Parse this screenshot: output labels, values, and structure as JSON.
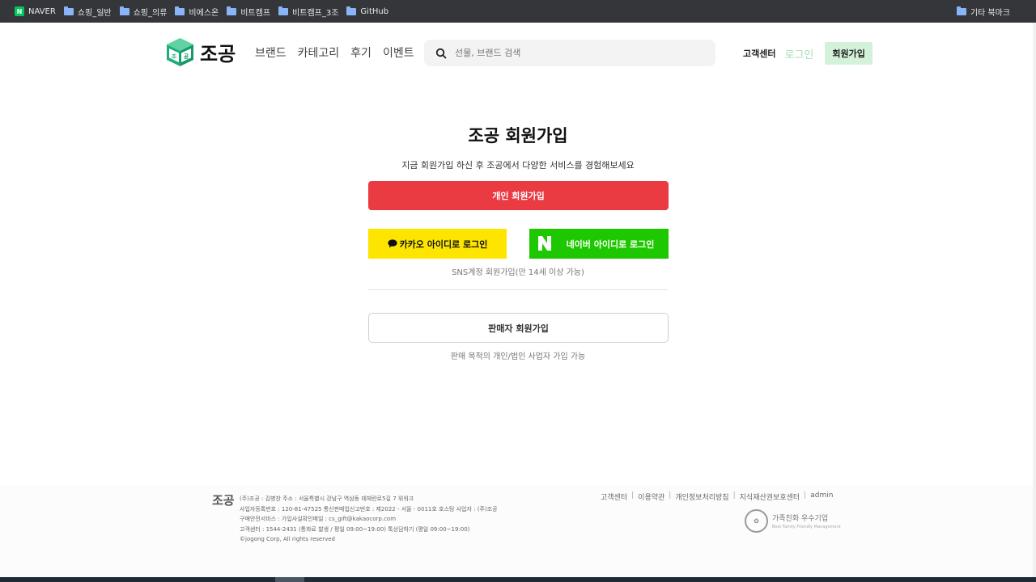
{
  "bookmarks": {
    "items": [
      "NAVER",
      "쇼핑_일반",
      "쇼핑_의류",
      "비에스온",
      "비트캠프",
      "비트캠프_3조",
      "GitHub"
    ],
    "other": "기타 북마크"
  },
  "header": {
    "logo_text": "조공",
    "logo_mark": "조공",
    "nav": [
      "브랜드",
      "카테고리",
      "후기",
      "이벤트"
    ],
    "search_placeholder": "선물, 브랜드 검색",
    "customer_center": "고객센터",
    "login": "로그인",
    "signup": "회원가입"
  },
  "main": {
    "title": "조공 회원가입",
    "subtitle": "지금 회원가입 하신 후 조공에서 다양한 서비스를 경험해보세요",
    "personal_signup": "개인 회원가입",
    "kakao_login": "카카오 아이디로 로그인",
    "naver_login": "네이버 아이디로 로그인",
    "sns_note": "SNS계정 회원가입(만 14세 이상 가능)",
    "seller_signup": "판매자 회원가입",
    "seller_note": "판매 목적의 개인/법인 사업자 가입 가능"
  },
  "footer": {
    "logo": "조공",
    "lines": [
      "(주)조공 : 김병찬     주소 : 서울특별시 강남구 역삼동 테헤란로5길 7 위워크",
      "사업자등록번호 : 120-81-47525     통신판매업신고번호 : 제2022 - 서울 - 0011호     호스팅 사업자 : (주)조공",
      "구매안전서비스 : 가입사실확인메일 : cs_gift@kakaocorp.com",
      "고객센터 : 1544-2431 (통화료 발생 / 평일 09:00~19:00) 톡상담하기 (평일 09:00~19:00)",
      "©jogong Corp, All rights reserved"
    ],
    "links": [
      "고객센터",
      "이용약관",
      "개인정보처리방침",
      "지식재산권보호센터",
      "admin"
    ],
    "badge_title": "가족친화 우수기업",
    "badge_sub": "Best Family Friendly Management"
  },
  "colors": {
    "accent_red": "#ea3a42",
    "kakao_yellow": "#fde500",
    "naver_green": "#1ec800",
    "logo_green": "#1fae7a"
  }
}
